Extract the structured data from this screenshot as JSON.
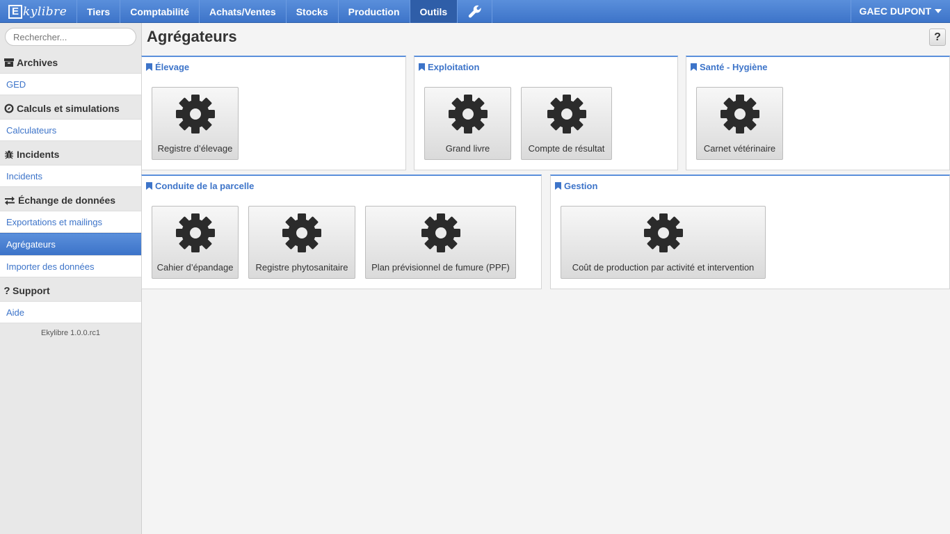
{
  "app": {
    "logo_letter": "E",
    "logo_text": "kylibre",
    "version": "Ekylibre 1.0.0.rc1"
  },
  "topnav": {
    "items": [
      "Tiers",
      "Comptabilité",
      "Achats/Ventes",
      "Stocks",
      "Production",
      "Outils"
    ],
    "active": "Outils",
    "tool_icon": "wrench-icon",
    "farm": "GAEC DUPONT"
  },
  "sidebar": {
    "search_placeholder": "Rechercher...",
    "sections": [
      {
        "title": "Archives",
        "icon": "archive-icon",
        "items": [
          "GED"
        ]
      },
      {
        "title": "Calculs et simulations",
        "icon": "compass-icon",
        "items": [
          "Calculateurs"
        ]
      },
      {
        "title": "Incidents",
        "icon": "bug-icon",
        "items": [
          "Incidents"
        ]
      },
      {
        "title": "Échange de données",
        "icon": "exchange-icon",
        "items": [
          "Exportations et mailings",
          "Agrégateurs",
          "Importer des données"
        ]
      },
      {
        "title": "Support",
        "icon": "question-icon",
        "items": [
          "Aide"
        ]
      }
    ],
    "selected_item": "Agrégateurs"
  },
  "page": {
    "title": "Agrégateurs",
    "help_label": "?"
  },
  "panels": [
    {
      "title": "Élevage",
      "tiles": [
        "Registre d’élevage"
      ]
    },
    {
      "title": "Exploitation",
      "tiles": [
        "Grand livre",
        "Compte de résultat"
      ]
    },
    {
      "title": "Santé - Hygiène",
      "tiles": [
        "Carnet vétérinaire"
      ]
    },
    {
      "title": "Conduite de la parcelle",
      "tiles": [
        "Cahier d’épandage",
        "Registre phytosanitaire",
        "Plan prévisionnel de fumure (PPF)"
      ]
    },
    {
      "title": "Gestion",
      "tiles": [
        "Coût de production par activité et intervention"
      ]
    }
  ],
  "colors": {
    "accent": "#3d74c9",
    "topbar": "#5a8fdb",
    "selected": "#2f5ea8"
  }
}
